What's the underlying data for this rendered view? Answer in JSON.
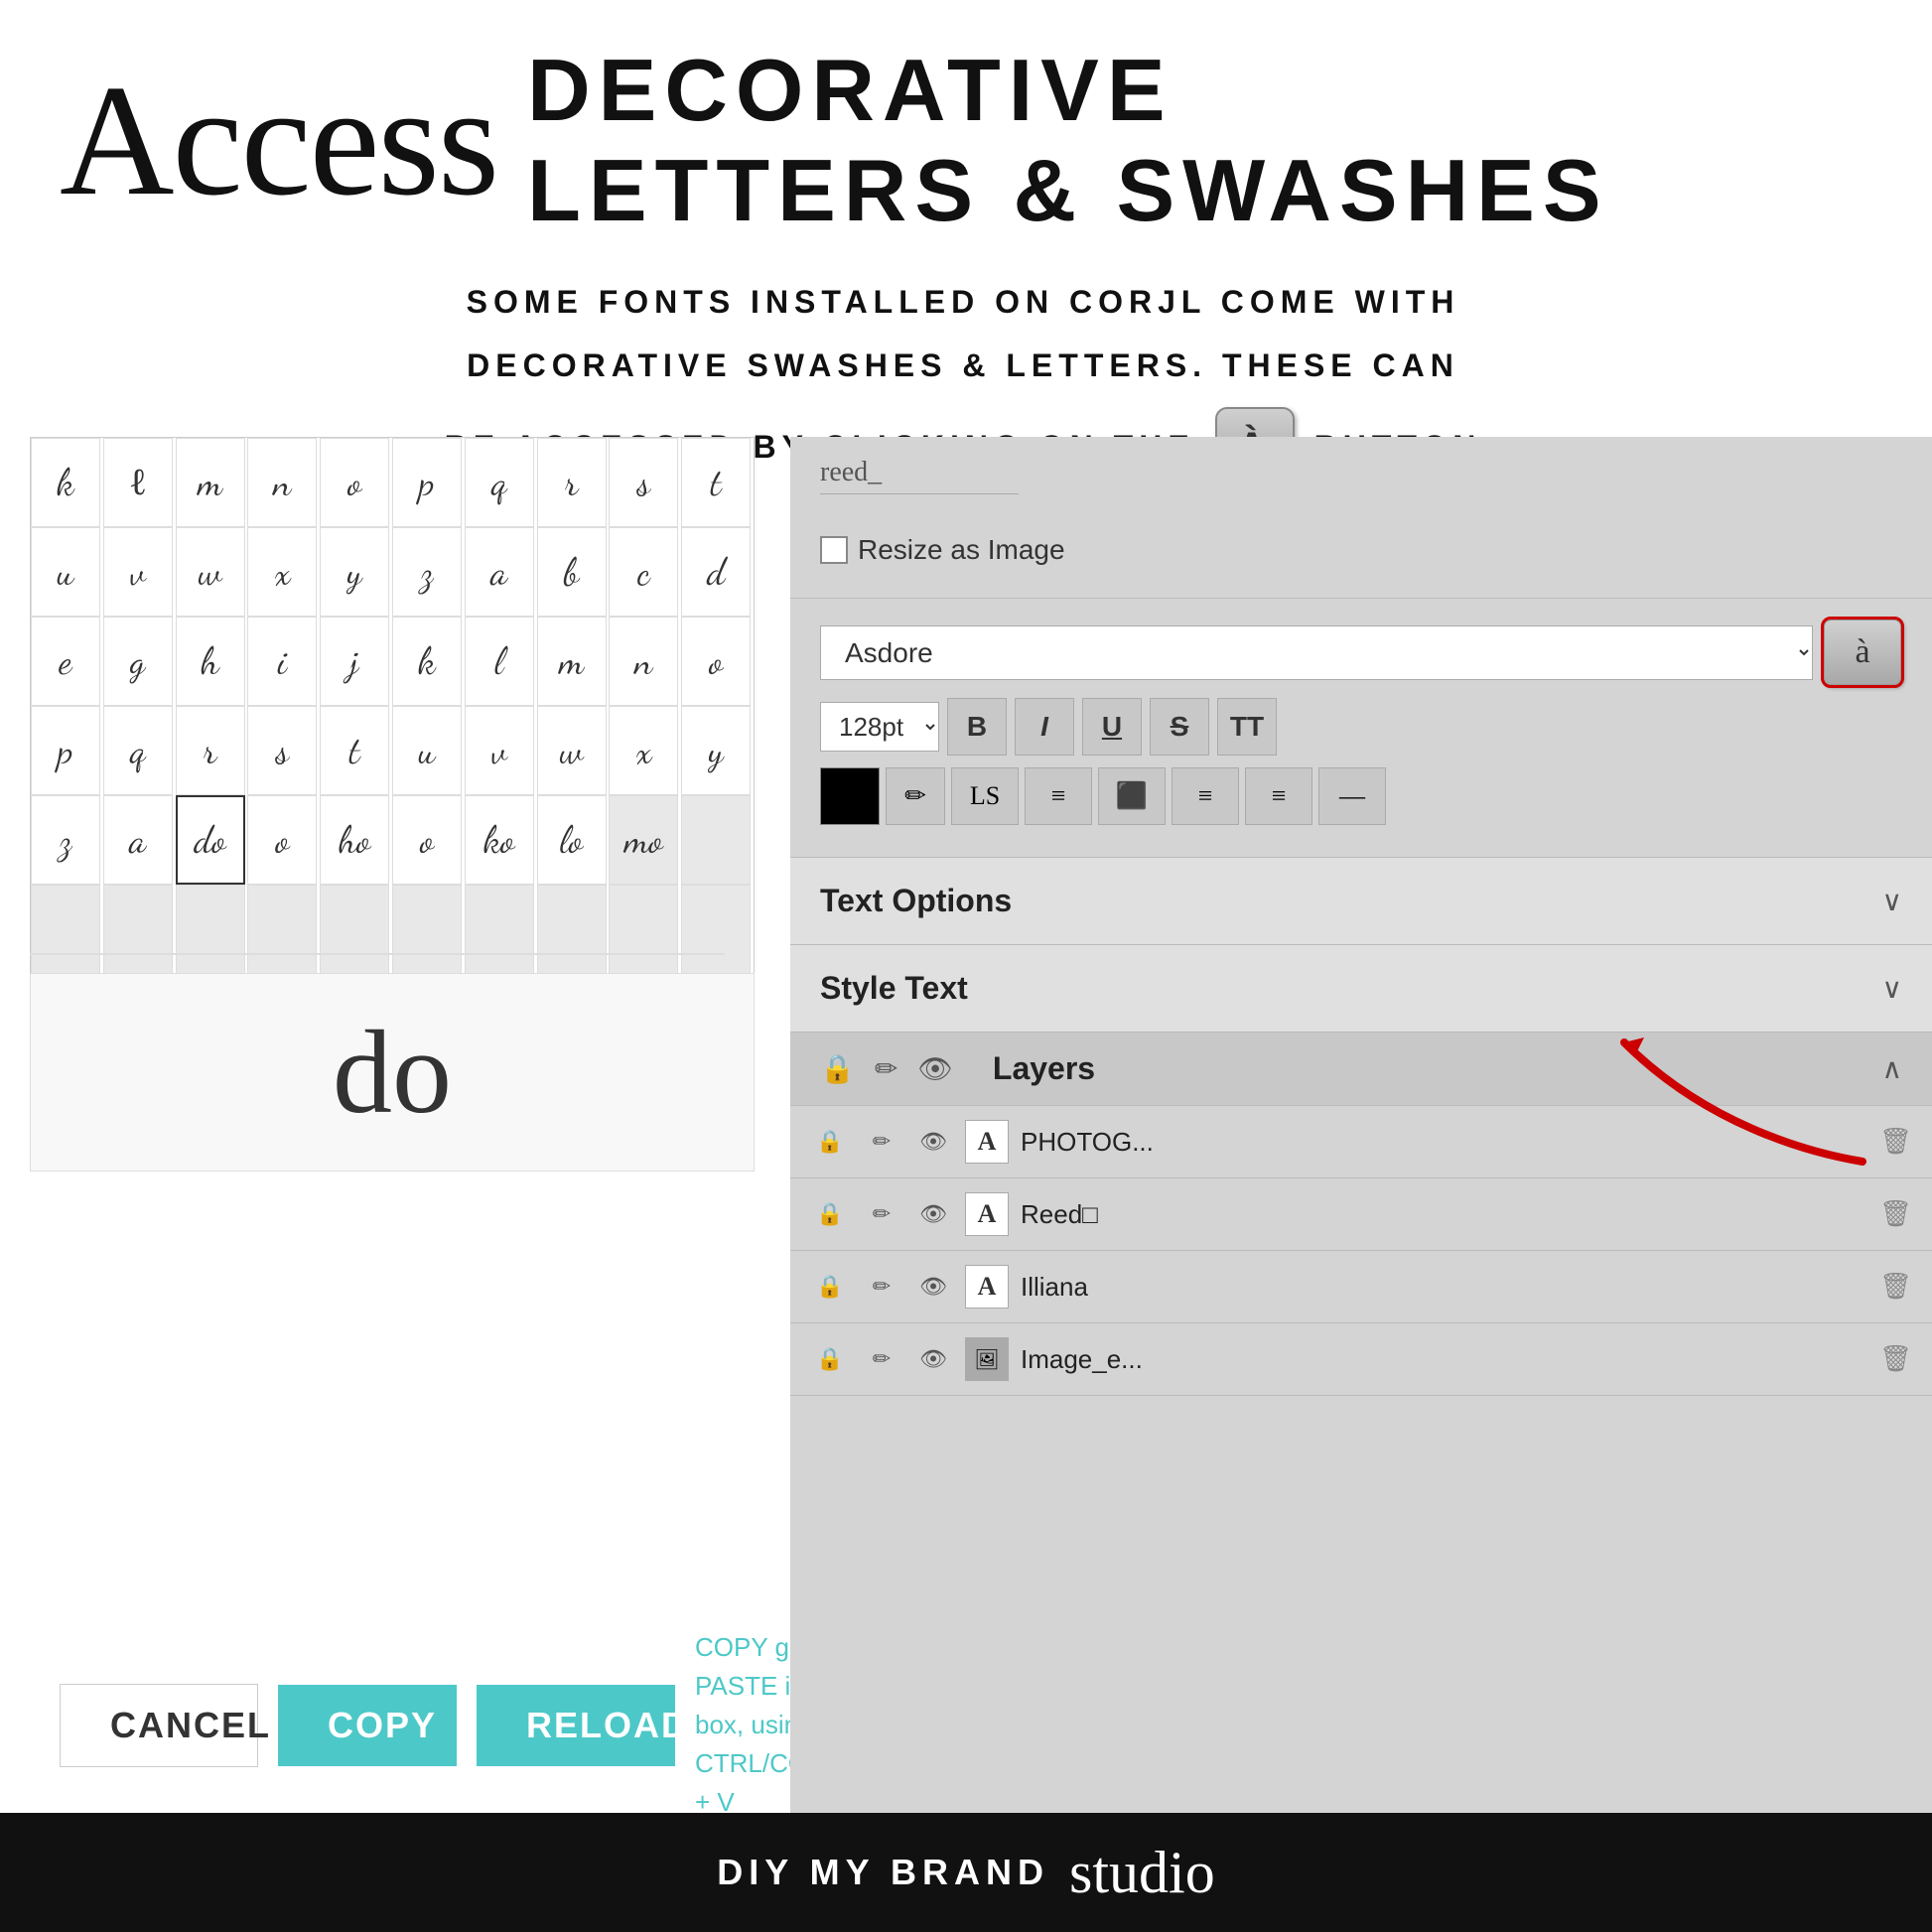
{
  "header": {
    "cursive_title": "Access",
    "decorative_line1": "DECORATIVE",
    "decorative_line2": "LETTERS & SWASHES",
    "subtitle_line1": "SOME FONTS INSTALLED ON CORJL COME WITH",
    "subtitle_line2": "DECORATIVE SWASHES & LETTERS. THESE CAN",
    "subtitle_line3": "BE ACCESSED BY CLICKING ON THE",
    "subtitle_line3_end": "BUTTON"
  },
  "glyph_panel": {
    "glyphs": [
      "k",
      "l",
      "m",
      "n",
      "o",
      "p",
      "q",
      "r",
      "s",
      "t",
      "u",
      "v",
      "w",
      "x",
      "y",
      "z",
      "a",
      "b",
      "c",
      "d",
      "e",
      "g",
      "h",
      "i",
      "j",
      "k",
      "l",
      "m",
      "n",
      "o",
      "p",
      "q",
      "r",
      "s",
      "t",
      "u",
      "v",
      "w",
      "x",
      "y",
      "z",
      "a",
      "do",
      "o",
      "ho",
      "o",
      "ko",
      "lo",
      "mo",
      ""
    ],
    "selected_glyph": "do",
    "preview_char": "do",
    "scroll_indicator": true
  },
  "buttons": {
    "cancel_label": "CANCEL",
    "copy_label": "COPY",
    "reload_label": "RELOAD",
    "copy_instruction": "COPY glyph, then PASTE into text box, using CTRL/COMMAND + V"
  },
  "right_panel": {
    "search_placeholder": "reed_",
    "resize_label": "Resize as Image",
    "font_name": "Asdore",
    "font_size": "128pt",
    "glyph_button_label": "à",
    "format_buttons": [
      "B",
      "I",
      "U",
      "S",
      "TT"
    ],
    "second_row_buttons": [
      "LS",
      "≡",
      "≡",
      "≡",
      "≡"
    ],
    "text_options_label": "Text Options",
    "style_text_label": "Style Text",
    "layers_label": "Layers",
    "layer_rows": [
      {
        "type": "A",
        "name": "PHOTOG...",
        "icon": "text"
      },
      {
        "type": "A",
        "name": "Reed□",
        "icon": "text"
      },
      {
        "type": "A",
        "name": "Illiana",
        "icon": "text"
      },
      {
        "type": "img",
        "name": "Image_e...",
        "icon": "image"
      }
    ]
  },
  "footer": {
    "brand_text": "DIY MY BRAND",
    "script_text": "studio"
  },
  "icons": {
    "chevron_down": "∨",
    "chevron_up": "∧",
    "lock": "🔒",
    "eye": "👁",
    "pencil": "✏",
    "trash": "🗑",
    "help": "?",
    "glyph_char": "à"
  }
}
